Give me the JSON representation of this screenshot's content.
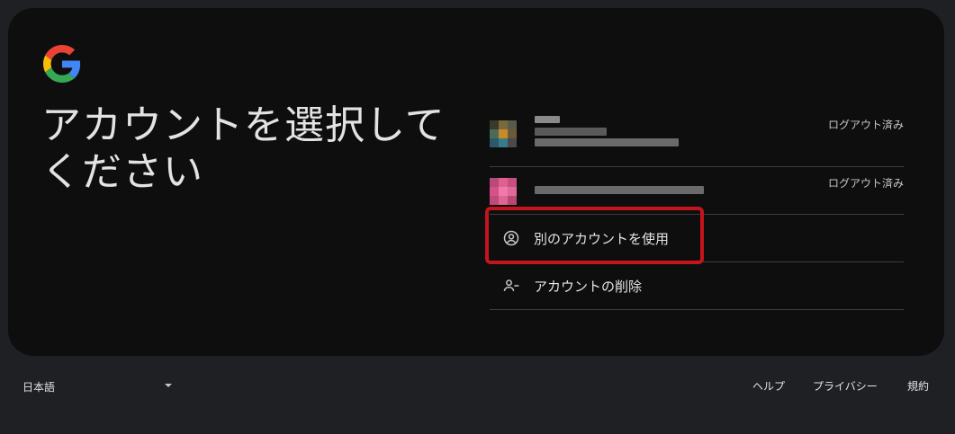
{
  "brand": {
    "logo": "google-g-logo"
  },
  "page_title": "アカウントを選択してください",
  "accounts": [
    {
      "status": "ログアウト済み"
    },
    {
      "status": "ログアウト済み"
    }
  ],
  "actions": {
    "use_other": {
      "label": "別のアカウントを使用",
      "icon": "account-circle-icon"
    },
    "remove": {
      "label": "アカウントの削除",
      "icon": "person-remove-icon"
    }
  },
  "footer": {
    "language": "日本語",
    "links": [
      "ヘルプ",
      "プライバシー",
      "規約"
    ]
  },
  "colors": {
    "background": "#1f2023",
    "card": "#0e0e0f",
    "divider": "#3c3d40",
    "highlight": "#c4141c",
    "text": "#e3e3e3"
  }
}
